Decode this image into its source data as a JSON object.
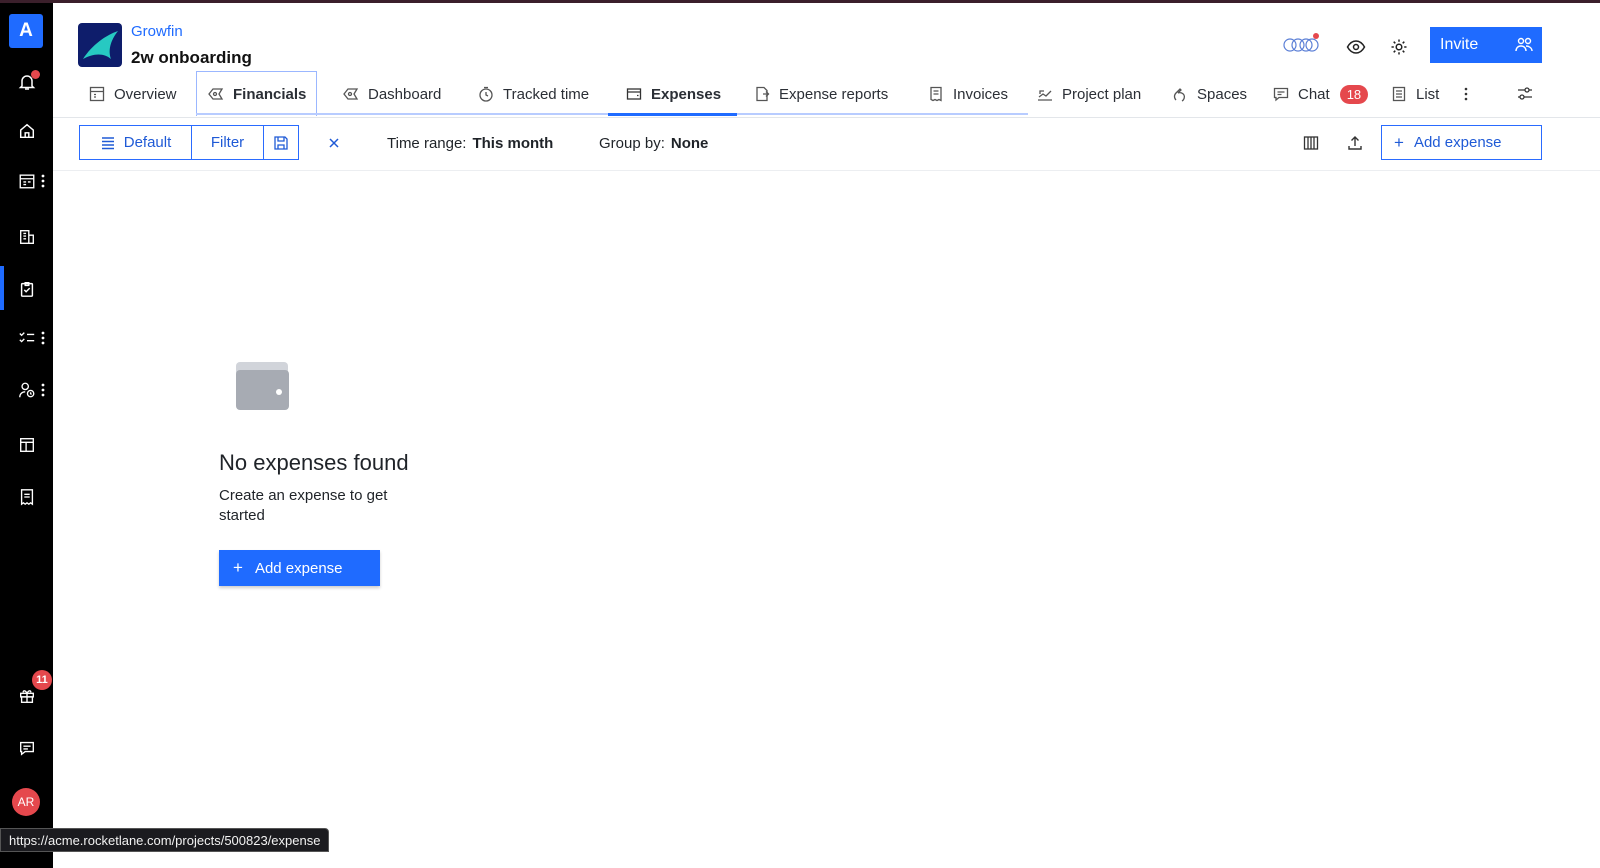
{
  "rail": {
    "logo_letter": "A",
    "gift_badge": "11",
    "avatar_initials": "AR"
  },
  "header": {
    "client_name": "Growfin",
    "project_name": "2w onboarding",
    "invite_label": "Invite"
  },
  "tabs": [
    {
      "label": "Overview",
      "icon": "overview-icon"
    },
    {
      "label": "Financials",
      "icon": "financials-icon"
    },
    {
      "label": "Dashboard",
      "icon": "dashboard-icon"
    },
    {
      "label": "Tracked time",
      "icon": "timer-icon"
    },
    {
      "label": "Expenses",
      "icon": "wallet-icon"
    },
    {
      "label": "Expense reports",
      "icon": "report-icon"
    },
    {
      "label": "Invoices",
      "icon": "invoice-icon"
    },
    {
      "label": "Project plan",
      "icon": "plan-icon"
    },
    {
      "label": "Spaces",
      "icon": "spaces-icon"
    },
    {
      "label": "Chat",
      "icon": "chat-icon",
      "badge": "18"
    },
    {
      "label": "List",
      "icon": "list-icon"
    }
  ],
  "toolbar": {
    "default_label": "Default",
    "filter_label": "Filter",
    "time_range_label": "Time range:",
    "time_range_value": "This month",
    "group_by_label": "Group by:",
    "group_by_value": "None",
    "add_expense_label": "Add expense"
  },
  "empty_state": {
    "title": "No expenses found",
    "subtitle": "Create an expense to get started",
    "button_label": "Add expense"
  },
  "status_bar": {
    "url": "https://acme.rocketlane.com/projects/500823/expense"
  },
  "colors": {
    "accent": "#1f6bff",
    "badge": "#e5484d",
    "rail": "#000000"
  }
}
